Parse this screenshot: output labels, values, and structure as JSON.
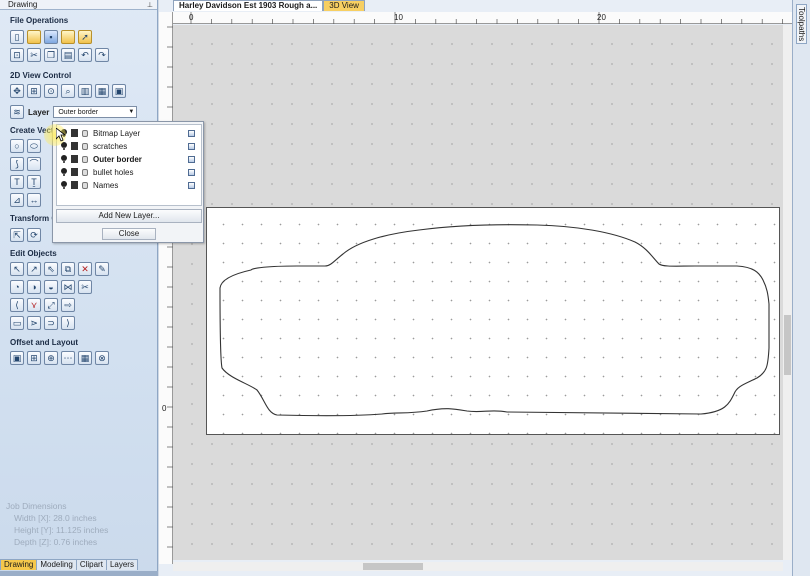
{
  "panel": {
    "title": "Drawing",
    "sections": {
      "file_operations": "File Operations",
      "view_control": "2D View Control",
      "create_vectors": "Create Vect",
      "transform": "Transform O",
      "edit_objects": "Edit Objects",
      "offset_layout": "Offset and Layout"
    },
    "layer_label": "Layer",
    "layer_selected": "Outer border",
    "job_dimensions": {
      "title": "Job Dimensions",
      "width": "Width  [X]: 28.0 inches",
      "height": "Height [Y]: 11.125 inches",
      "depth": "Depth  [Z]: 0.76 inches"
    },
    "tabs": [
      "Drawing",
      "Modeling",
      "Clipart",
      "Layers"
    ]
  },
  "document": {
    "tabs": [
      "Harley Davidson Est 1903 Rough a...",
      "3D View"
    ],
    "ruler_top": [
      "0",
      "10",
      "20"
    ],
    "ruler_left": [
      "0"
    ]
  },
  "right_strip": {
    "toolpaths_label": "Toolpaths"
  },
  "layer_popup": {
    "layers": [
      {
        "name": "Bitmap Layer",
        "active": false
      },
      {
        "name": "scratches",
        "active": false
      },
      {
        "name": "Outer border",
        "active": true
      },
      {
        "name": "bullet holes",
        "active": false
      },
      {
        "name": "Names",
        "active": false
      }
    ],
    "add_button": "Add New Layer...",
    "close_button": "Close"
  },
  "colors": {
    "panel_bg": "#d2e0f0",
    "active_tab": "#f6c84b",
    "canvas_bg": "#dadada",
    "sheet_bg": "#ffffff"
  }
}
